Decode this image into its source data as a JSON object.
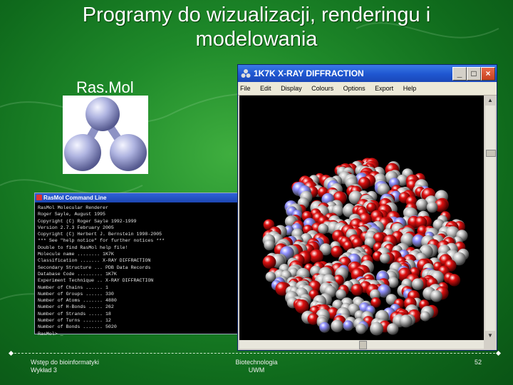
{
  "slide": {
    "title_line1": "Programy do wizualizacji, renderingu i",
    "title_line2": "modelowania",
    "rasmol_label": "Ras.Mol",
    "page_number": "52"
  },
  "footer": {
    "left_line1": "Wstęp do bioinformatyki",
    "left_line2": "Wykład 3",
    "center_line1": "Biotechnologia",
    "center_line2": "UWM"
  },
  "command_window": {
    "title": "RasMol Command Line",
    "lines": [
      "RasMol Molecular Renderer",
      "Roger Sayle, August 1995",
      "Copyright (C) Roger Sayle 1992-1999",
      "Version 2.7.3 February 2005",
      "Copyright (C) Herbert J. Bernstein 1998-2005",
      "*** See \"help notice\" for further notices ***",
      "Double to find RasMol help file!",
      "Molecule name ........ 1K7K",
      "Classification ....... X-RAY DIFFRACTION",
      "Secondary Structure ... PDB Data Records",
      "Database Code ......... 1K7K",
      "Experiment Technique .. X-RAY DIFFRACTION",
      "Number of Chains ...... 1",
      "Number of Groups ...... 330",
      "Number of Atoms ....... 4880",
      "Number of H-Bonds ..... 262",
      "Number of Strands ..... 18",
      "Number of Turns ....... 12",
      "Number of Bonds ....... 5020",
      "",
      "RasMol> _"
    ]
  },
  "main_window": {
    "title": "1K7K X-RAY DIFFRACTION",
    "menu": [
      "File",
      "Edit",
      "Display",
      "Colours",
      "Options",
      "Export",
      "Help"
    ],
    "min_glyph": "_",
    "max_glyph": "□",
    "close_glyph": "×"
  },
  "colors": {
    "background_green": "#1f8a2a",
    "atom_oxygen": "#e01010",
    "atom_carbon": "#c8c8c8",
    "atom_nitrogen": "#8f8fff",
    "logo_atom": "#aab0dd"
  }
}
